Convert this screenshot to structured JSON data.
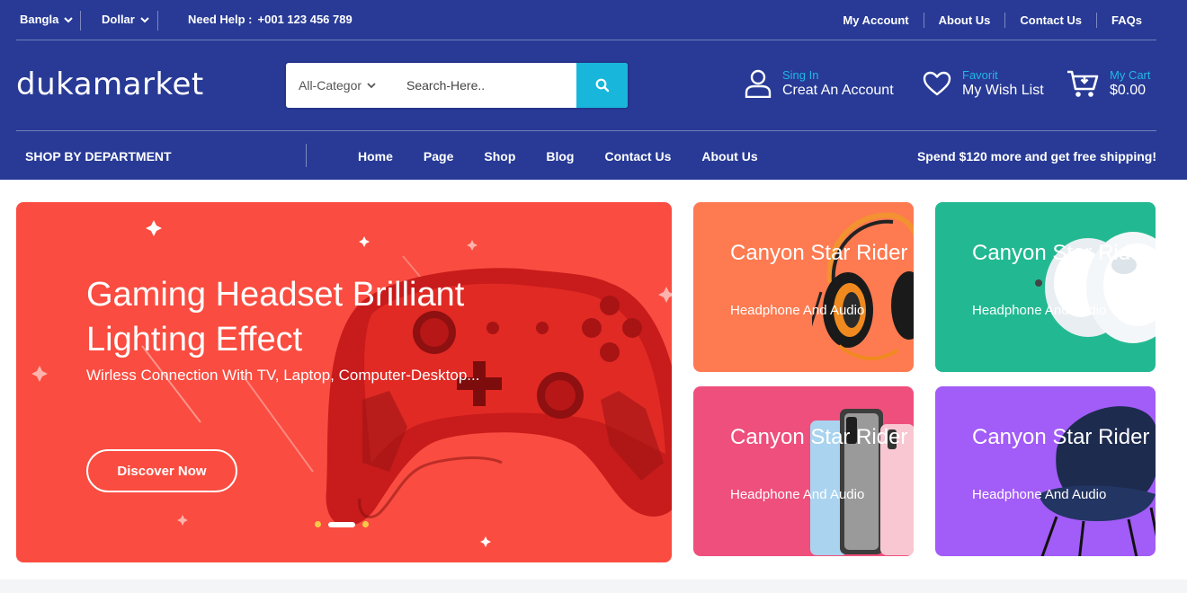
{
  "topbar": {
    "language": "Bangla",
    "currency": "Dollar",
    "help_label": "Need Help :",
    "help_phone": "+001 123 456 789",
    "links": [
      "My Account",
      "About Us",
      "Contact Us",
      "FAQs"
    ]
  },
  "header": {
    "logo": "dukamarket",
    "category_select": "All-Categor",
    "search_placeholder": "Search-Here..",
    "account_small": "Sing In",
    "account_big": "Creat An Account",
    "wishlist_small": "Favorit",
    "wishlist_big": "My Wish List",
    "cart_small": "My Cart",
    "cart_big": "$0.00"
  },
  "nav": {
    "department": "SHOP BY DEPARTMENT",
    "items": [
      "Home",
      "Page",
      "Shop",
      "Blog",
      "Contact Us",
      "About Us"
    ],
    "shipping_note": "Spend $120 more and get free shipping!"
  },
  "hero": {
    "title": "Gaming Headset Brilliant Lighting Effect",
    "subtitle": "Wirless Connection With TV, Laptop, Computer-Desktop...",
    "cta": "Discover Now",
    "slide_count": 3,
    "active_slide": 2
  },
  "promos": [
    {
      "title": "Canyon Star Rider",
      "subtitle": "Headphone And Audio",
      "color": "#fe7a51",
      "image": "headphones"
    },
    {
      "title": "Canyon Star Rider",
      "subtitle": "Headphone And Audio",
      "color": "#22b992",
      "image": "earbuds"
    },
    {
      "title": "Canyon Star Rider",
      "subtitle": "Headphone And Audio",
      "color": "#ef4f7c",
      "image": "phones"
    },
    {
      "title": "Canyon Star Rider",
      "subtitle": "Headphone And Audio",
      "color": "#a25cf7",
      "image": "armchair"
    }
  ],
  "colors": {
    "header_bg": "#283a96",
    "accent": "#18b6db",
    "hero_bg": "#fa4c40"
  }
}
